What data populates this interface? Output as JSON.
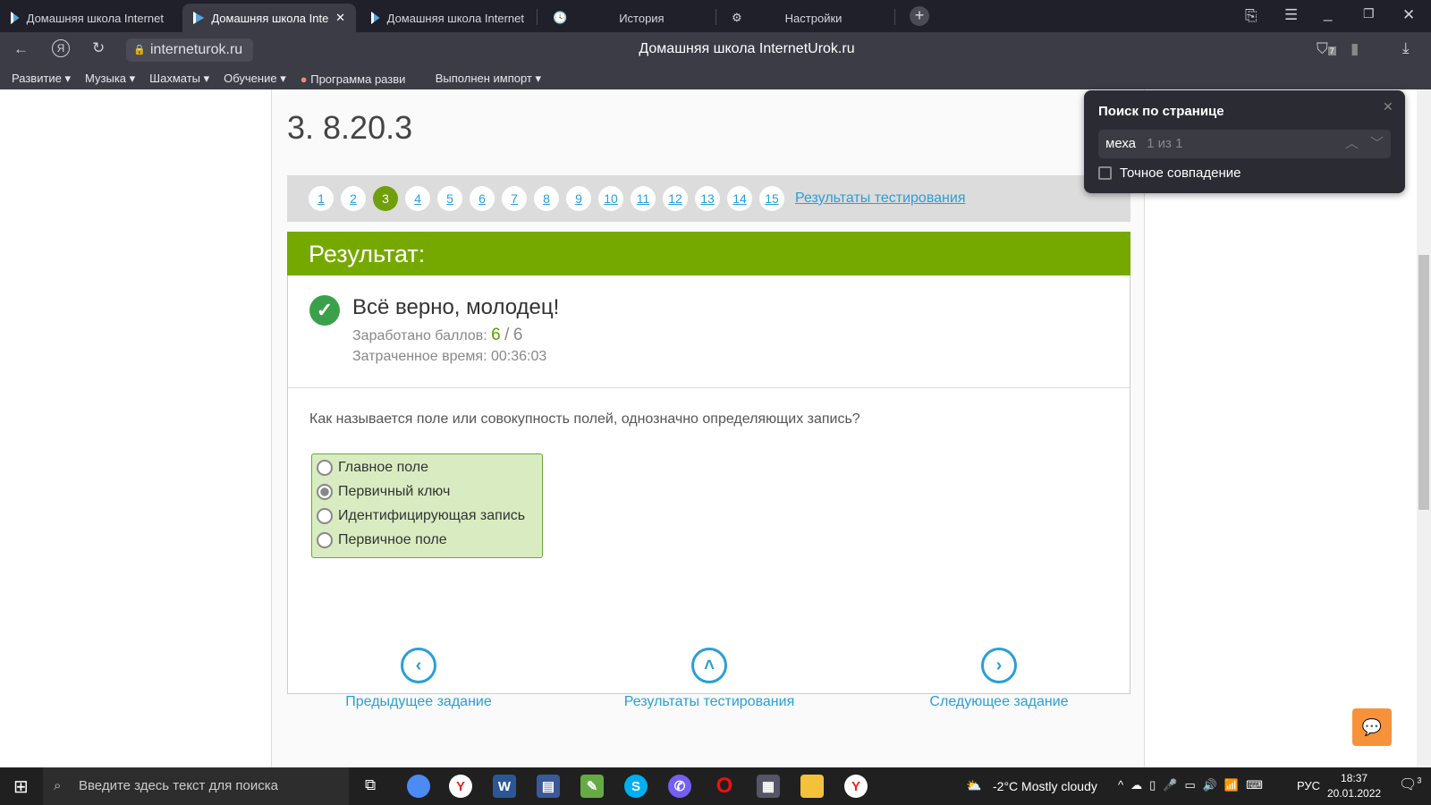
{
  "tabs": [
    {
      "label": "Домашняя школа Internet"
    },
    {
      "label": "Домашняя школа Intern"
    },
    {
      "label": "Домашняя школа Internet"
    },
    {
      "label": "История"
    },
    {
      "label": "Настройки"
    }
  ],
  "address": {
    "url": "interneturok.ru",
    "title": "Домашняя школа InternetUrok.ru",
    "shield_count": "7"
  },
  "bookmarks": [
    "Развитие",
    "Музыка",
    "Шахматы",
    "Обучение",
    "Программа разви",
    "Выполнен импорт"
  ],
  "page": {
    "title": "3. 8.20.3",
    "pages": [
      "1",
      "2",
      "3",
      "4",
      "5",
      "6",
      "7",
      "8",
      "9",
      "10",
      "11",
      "12",
      "13",
      "14",
      "15"
    ],
    "current_page": "3",
    "results_link": "Результаты тестирования",
    "result_header": "Результат:",
    "result_message": "Всё верно, молодец!",
    "score_label": "Заработано баллов:",
    "score": "6",
    "score_sep": "/",
    "score_max": "6",
    "time_label": "Затраченное время: 00:36:03",
    "question": "Как называется поле или совокупность полей, однозначно определяющих запись?",
    "answers": [
      {
        "label": "Главное поле",
        "selected": false
      },
      {
        "label": "Первичный ключ",
        "selected": true
      },
      {
        "label": "Идентифицирующая запись",
        "selected": false
      },
      {
        "label": "Первичное поле",
        "selected": false
      }
    ],
    "prev": "Предыдущее задание",
    "results": "Результаты тестирования",
    "next": "Следующее задание"
  },
  "find": {
    "title": "Поиск по странице",
    "query": "меха",
    "count": "1 из 1",
    "exact": "Точное совпадение"
  },
  "taskbar": {
    "search_placeholder": "Введите здесь текст для поиска",
    "weather": "-2°C  Mostly cloudy",
    "lang": "РУС",
    "time": "18:37",
    "date": "20.01.2022",
    "notifications": "3"
  },
  "colors": {
    "green": "#76a900",
    "link": "#2a9fd6",
    "chat": "#f7923a"
  }
}
